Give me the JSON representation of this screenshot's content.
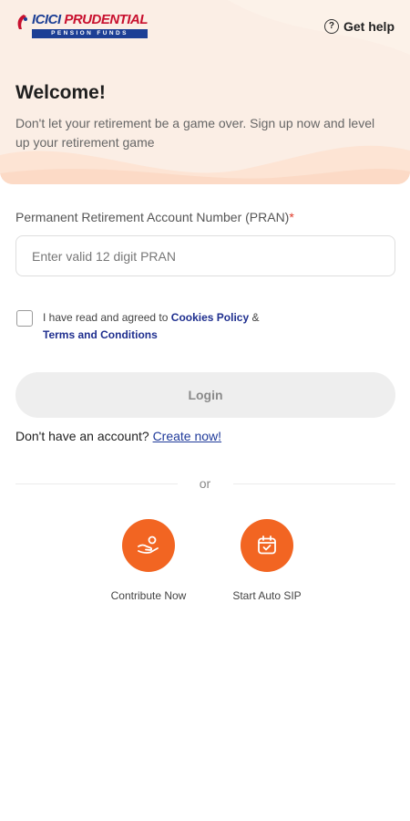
{
  "header": {
    "logo": {
      "brand_a": "ICICI ",
      "brand_b": "PRUDENTIAL",
      "sub": "PENSION FUNDS"
    },
    "help_label": "Get help",
    "help_icon": "question-circle-icon"
  },
  "welcome": {
    "title": "Welcome!",
    "subtitle": "Don't let your retirement be a game over. Sign up now and level up your retirement game"
  },
  "form": {
    "pran_label": "Permanent Retirement Account Number (PRAN)",
    "required_mark": "*",
    "pran_placeholder": "Enter valid 12 digit PRAN",
    "pran_value": "",
    "agree_prefix": "I have read and agreed to ",
    "cookies_link": "Cookies Policy",
    "agree_and": " & ",
    "terms_link": "Terms and Conditions",
    "login_label": "Login",
    "no_account_text": "Don't have an account? ",
    "create_link": "Create now!"
  },
  "or_text": "or",
  "actions": [
    {
      "label": "Contribute Now",
      "icon": "hand-coin-icon"
    },
    {
      "label": "Start Auto SIP",
      "icon": "calendar-check-icon"
    }
  ],
  "colors": {
    "accent": "#f26522",
    "brand_blue": "#1c3f95",
    "brand_red": "#c8102e",
    "hero_bg": "#fbeee5",
    "link": "#1f2f8f"
  }
}
